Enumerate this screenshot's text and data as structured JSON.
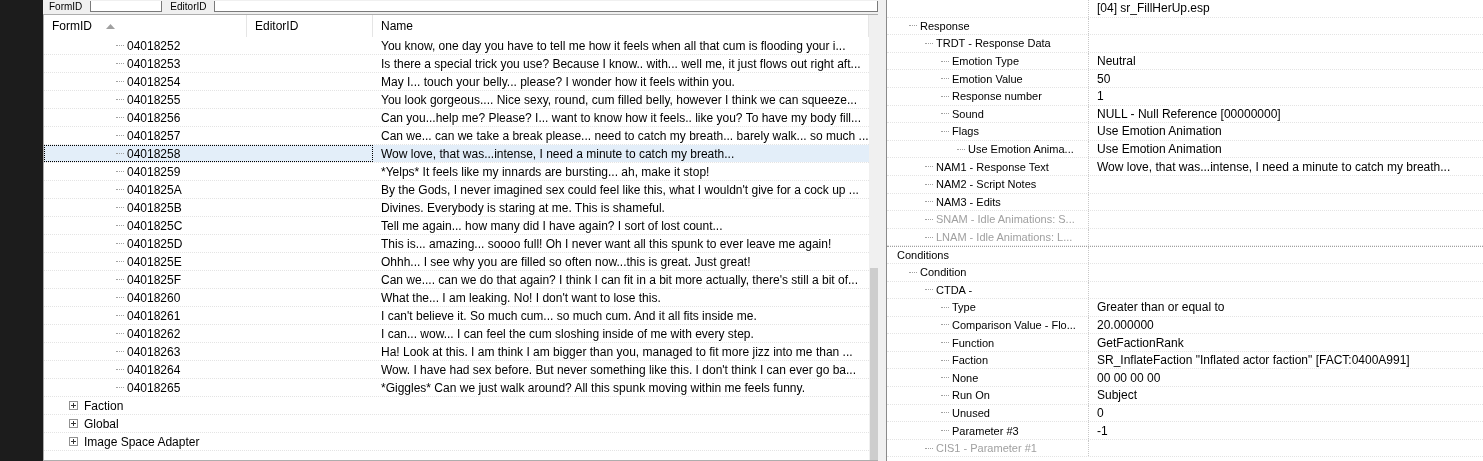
{
  "filter_bar": {
    "labels": [
      "FormID",
      "EditorID"
    ]
  },
  "records_table": {
    "columns": [
      "FormID",
      "EditorID",
      "Name"
    ],
    "rows": [
      {
        "kind": "record",
        "form_id": "04018252",
        "name": "You know, one day you have to tell me how it feels when all that cum is flooding your i...",
        "selected": false
      },
      {
        "kind": "record",
        "form_id": "04018253",
        "name": "Is there a special trick you use? Because I know.. with... well me, it just flows out right aft...",
        "selected": false
      },
      {
        "kind": "record",
        "form_id": "04018254",
        "name": "May I... touch your belly... please? I wonder how it feels within you.",
        "selected": false
      },
      {
        "kind": "record",
        "form_id": "04018255",
        "name": "You look gorgeous.... Nice sexy, round, cum filled belly, however I think we can squeeze...",
        "selected": false
      },
      {
        "kind": "record",
        "form_id": "04018256",
        "name": "Can you...help me? Please? I... want to know how it feels.. like you? To have my body fill...",
        "selected": false
      },
      {
        "kind": "record",
        "form_id": "04018257",
        "name": "Can we... can we take a break please... need to catch my breath... barely walk... so much ...",
        "selected": false
      },
      {
        "kind": "record",
        "form_id": "04018258",
        "name": "Wow love, that was...intense, I need a minute to catch my breath...",
        "selected": true
      },
      {
        "kind": "record",
        "form_id": "04018259",
        "name": "*Yelps* It feels like my innards are bursting... ah, make it stop!",
        "selected": false
      },
      {
        "kind": "record",
        "form_id": "0401825A",
        "name": "By the Gods, I never imagined sex could feel like this, what I wouldn't give for a cock up ...",
        "selected": false
      },
      {
        "kind": "record",
        "form_id": "0401825B",
        "name": "Divines. Everybody is staring at me. This is shameful.",
        "selected": false
      },
      {
        "kind": "record",
        "form_id": "0401825C",
        "name": "Tell me again... how many did I have again? I sort of lost count...",
        "selected": false
      },
      {
        "kind": "record",
        "form_id": "0401825D",
        "name": "This is... amazing... soooo full! Oh I never want all this spunk to ever leave me again!",
        "selected": false
      },
      {
        "kind": "record",
        "form_id": "0401825E",
        "name": "Ohhh... I see why you are filled so often now...this is great. Just great!",
        "selected": false
      },
      {
        "kind": "record",
        "form_id": "0401825F",
        "name": "Can we.... can we do that again? I think I can fit in a bit more actually, there's still a bit of...",
        "selected": false
      },
      {
        "kind": "record",
        "form_id": "04018260",
        "name": "What the... I am leaking. No! I don't want to lose this.",
        "selected": false
      },
      {
        "kind": "record",
        "form_id": "04018261",
        "name": "I can't believe it. So much cum... so much cum. And it all fits inside me.",
        "selected": false
      },
      {
        "kind": "record",
        "form_id": "04018262",
        "name": "I can... wow... I can feel the cum sloshing inside of me with every step.",
        "selected": false
      },
      {
        "kind": "record",
        "form_id": "04018263",
        "name": "Ha! Look at this. I am think I am bigger than you, managed to fit more jizz into me than ...",
        "selected": false
      },
      {
        "kind": "record",
        "form_id": "04018264",
        "name": "Wow. I have had sex before. But never something like this. I don't think I can ever go ba...",
        "selected": false
      },
      {
        "kind": "record",
        "form_id": "04018265",
        "name": "*Giggles* Can we just walk around? All this spunk moving within me feels funny.",
        "selected": false
      },
      {
        "kind": "group",
        "label": "Faction",
        "expanded": false
      },
      {
        "kind": "group",
        "label": "Global",
        "expanded": false
      },
      {
        "kind": "group",
        "label": "Image Space Adapter",
        "expanded": false
      }
    ]
  },
  "record_view": {
    "file": "[04] sr_FillHerUp.esp",
    "sections": [
      {
        "label": "Response",
        "disabled": false,
        "children": [
          {
            "label": "TRDT - Response Data",
            "disabled": false,
            "children": [
              {
                "label": "Emotion Type",
                "value": "Neutral",
                "disabled": false
              },
              {
                "label": "Emotion Value",
                "value": "50",
                "disabled": false
              },
              {
                "label": "Response number",
                "value": "1",
                "disabled": false
              },
              {
                "label": "Sound",
                "value": "NULL - Null Reference [00000000]",
                "disabled": false
              },
              {
                "label": "Flags",
                "value": "Use Emotion Animation",
                "disabled": false,
                "children": [
                  {
                    "label": "Use Emotion Anima...",
                    "value": "Use Emotion Animation",
                    "disabled": false
                  }
                ]
              }
            ]
          },
          {
            "label": "NAM1 - Response Text",
            "value": "Wow love, that was...intense, I need a minute to catch my breath...",
            "disabled": false
          },
          {
            "label": "NAM2 - Script Notes",
            "disabled": false
          },
          {
            "label": "NAM3 - Edits",
            "disabled": false
          },
          {
            "label": "SNAM - Idle Animations: S...",
            "disabled": true
          },
          {
            "label": "LNAM - Idle Animations: L...",
            "disabled": true
          }
        ]
      },
      {
        "label": "Conditions",
        "disabled": false,
        "top_level": true,
        "children": [
          {
            "label": "Condition",
            "disabled": false,
            "children": [
              {
                "label": "CTDA -",
                "disabled": false,
                "children": [
                  {
                    "label": "Type",
                    "value": "Greater than or equal to",
                    "disabled": false
                  },
                  {
                    "label": "Comparison Value - Flo...",
                    "value": "20.000000",
                    "disabled": false
                  },
                  {
                    "label": "Function",
                    "value": "GetFactionRank",
                    "disabled": false
                  },
                  {
                    "label": "Faction",
                    "value": "SR_InflateFaction \"Inflated actor faction\" [FACT:0400A991]",
                    "disabled": false
                  },
                  {
                    "label": "None",
                    "value": "00 00 00 00",
                    "disabled": false
                  },
                  {
                    "label": "Run On",
                    "value": "Subject",
                    "disabled": false
                  },
                  {
                    "label": "Unused",
                    "value": "0",
                    "disabled": false
                  },
                  {
                    "label": "Parameter #3",
                    "value": "-1",
                    "disabled": false
                  }
                ]
              },
              {
                "label": "CIS1 - Parameter #1",
                "disabled": true
              }
            ]
          }
        ]
      }
    ]
  }
}
